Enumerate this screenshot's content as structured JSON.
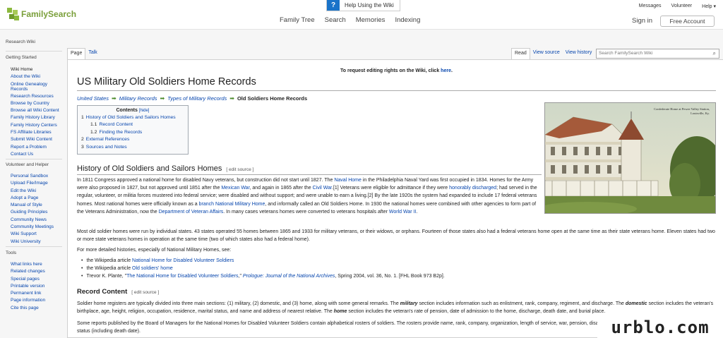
{
  "header": {
    "logo_text": "FamilySearch",
    "help_label": "Help Using the Wiki",
    "help_icon": "?",
    "nav": [
      "Family Tree",
      "Search",
      "Memories",
      "Indexing"
    ],
    "util": [
      "Messages",
      "Volunteer",
      "Help ▾"
    ],
    "sign_in": "Sign in",
    "free_account": "Free Account"
  },
  "sidebar": {
    "research_wiki": "Research Wiki",
    "getting_started": "Getting Started",
    "getting_started_items": [
      "Wiki Home",
      "About the Wiki",
      "Online Genealogy Records",
      "Research Resources",
      "Browse by Country",
      "Browse all Wiki Content",
      "Family History Library",
      "Family History Centers",
      "FS Affiliate Libraries",
      "Submit Wiki Content",
      "Report a Problem",
      "Contact Us"
    ],
    "volunteer": "Volunteer and Helper",
    "volunteer_items": [
      "Personal Sandbox",
      "Upload File/Image",
      "Edit the Wiki",
      "Adopt a Page",
      "Manual of Style",
      "Guiding Principles",
      "Community News",
      "Community Meetings",
      "Wiki Support",
      "Wiki University"
    ],
    "tools": "Tools",
    "tools_items": [
      "What links here",
      "Related changes",
      "Special pages",
      "Printable version",
      "Permanent link",
      "Page information",
      "Cite this page"
    ]
  },
  "tabs": {
    "page": "Page",
    "talk": "Talk",
    "read": "Read",
    "view_source": "View source",
    "view_history": "View history",
    "search_placeholder": "Search FamilySearch Wiki"
  },
  "content": {
    "notice_a": "To request editing rights on the Wiki, click ",
    "notice_link": "here",
    "notice_b": ".",
    "title": "US Military Old Soldiers Home Records",
    "crumbs": [
      "United States",
      "Military Records",
      "Types of Military Records"
    ],
    "crumb_current": "Old Soldiers Home Records",
    "toc_title": "Contents",
    "toc_hide": "[hide]",
    "toc": [
      {
        "n": "1",
        "label": "History of Old Soldiers and Sailors Homes",
        "sub": false
      },
      {
        "n": "1.1",
        "label": "Record Content",
        "sub": true
      },
      {
        "n": "1.2",
        "label": "Finding the Records",
        "sub": true
      },
      {
        "n": "2",
        "label": "External References",
        "sub": false
      },
      {
        "n": "3",
        "label": "Sources and Notes",
        "sub": false
      }
    ],
    "photo_caption": "Confederate Home at Pewee Valley Station, Louisville, Ky.",
    "edit_source": "[ edit source ]",
    "h2_history": "History of Old Soldiers and Sailors Homes",
    "p1": [
      "In 1811 Congress approved a national home for disabled Navy veterans, but construction did not start until 1827. The ",
      "Naval Home",
      " in the Philadelphia Naval Yard was first occupied in 1834. Homes for the Army were also proposed in 1827, but not approved until 1851 after the ",
      "Mexican War",
      ", and again in 1865 after the ",
      "Civil War",
      ".[1] Veterans were eligible for admittance if they were ",
      "honorably discharged",
      "; had served in the regular, volunteer, or militia forces mustered into federal service; were disabled and without support; and were unable to earn a living.[2] By the late 1920s the system had expanded to include 17 federal veterans homes. Most national homes were officially known as a ",
      "branch National Military Home",
      ", and informally called an Old Soldiers Home. In 1930 the national homes were combined with other agencies to form part of the Veterans Administration, now the ",
      "Department of Veteran Affairs",
      ". In many cases veterans homes were converted to veterans hospitals after ",
      "World War II",
      "."
    ],
    "p2": "Most old soldier homes were run by individual states. 43 states operated 55 homes between 1865 and 1933 for military veterans, or their widows, or orphans. Fourteen of those states also had a federal veterans home open at the same time as their state veterans home. Eleven states had two or more state veterans homes in operation at the same time (two of which states also had a federal home).",
    "p3": "For more detailed histories, especially of National Military Homes, see:",
    "bullets": [
      [
        "the Wikipedia article ",
        "National Home for Disabled Volunteer Soldiers",
        ""
      ],
      [
        "the Wikipedia article ",
        "Old soldiers' home",
        ""
      ],
      [
        "Trevor K. Plante, \"",
        "The National Home for Disabled Volunteer Soldiers",
        ",\" ",
        "Prologue: Journal of the National Archives",
        ", Spring 2004, vol. 36, No. 1. [FHL Book 973 B2p]."
      ]
    ],
    "h3_record": "Record Content",
    "p4": [
      "Soldier home registers are typically divided into three main sections: (1) military, (2) domestic, and (3) home, along with some general remarks. The ",
      "military",
      " section includes information such as enlistment, rank, company, regiment, and discharge. The ",
      "domestic",
      " section includes the veteran's birthplace, age, height, religion, occupation, residence, marital status, and name and address of nearest relative. The ",
      "home",
      " section includes the veteran's rate of pension, date of admission to the home, discharge, death date, and burial place."
    ],
    "p5": "Some reports published by the Board of Managers for the National Homes for Disabled Volunteer Soldiers contain alphabetical rosters of soldiers. The rosters provide name, rank, company, organization, length of service, war, pension, disability, and date of admission, when admitted, and status (including death date)."
  },
  "watermark": "urblo.com"
}
